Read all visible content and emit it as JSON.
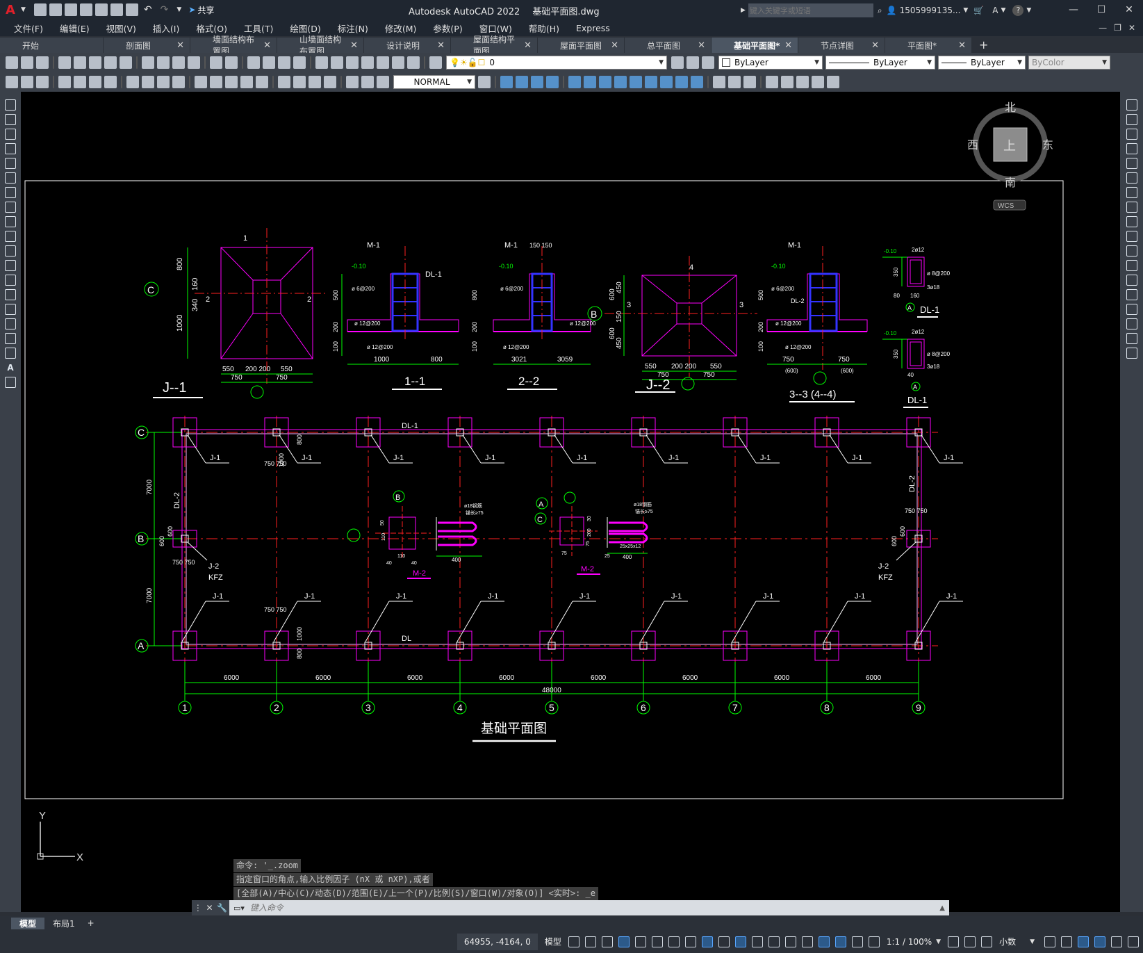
{
  "app": {
    "title": "Autodesk AutoCAD 2022",
    "filename": "基础平面图.dwg",
    "share_label": "共享",
    "search_placeholder": "键入关键字或短语",
    "user": "1505999135...",
    "help": "?"
  },
  "menu": [
    "文件(F)",
    "编辑(E)",
    "视图(V)",
    "插入(I)",
    "格式(O)",
    "工具(T)",
    "绘图(D)",
    "标注(N)",
    "修改(M)",
    "参数(P)",
    "窗口(W)",
    "帮助(H)",
    "Express"
  ],
  "tabs": [
    {
      "label": "开始",
      "active": false
    },
    {
      "label": "剖面图",
      "active": false
    },
    {
      "label": "墙面结构布置图",
      "active": false
    },
    {
      "label": "山墙面结构布置图",
      "active": false
    },
    {
      "label": "设计说明",
      "active": false
    },
    {
      "label": "屋面结构平面图",
      "active": false
    },
    {
      "label": "屋面平面图",
      "active": false
    },
    {
      "label": "总平面图",
      "active": false
    },
    {
      "label": "基础平面图*",
      "active": true
    },
    {
      "label": "节点详图",
      "active": false
    },
    {
      "label": "平面图*",
      "active": false
    }
  ],
  "toolbar": {
    "layer_value": "0",
    "color_value": "ByLayer",
    "linetype_value": "ByLayer",
    "lineweight_value": "ByLayer",
    "plotstyle_value": "ByColor",
    "dimstyle_value": "NORMAL"
  },
  "viewcube": {
    "north": "北",
    "south": "南",
    "east": "东",
    "west": "西",
    "top": "上",
    "wcs": "WCS"
  },
  "drawing": {
    "title": "基础平面图",
    "section_labels": [
      "J--1",
      "1--1",
      "2--2",
      "J--2",
      "3--3 (4--4)",
      "DL-1",
      "DL-1"
    ],
    "axis_rows": [
      "C",
      "B",
      "A"
    ],
    "axis_cols": [
      "1",
      "2",
      "3",
      "4",
      "5",
      "6",
      "7",
      "8",
      "9"
    ],
    "bay_width": "6000",
    "total_width": "48000",
    "row_spacing": "7000",
    "labels": {
      "j1": "J-1",
      "j2": "J-2",
      "kfz": "KFZ",
      "dl1": "DL-1",
      "dl2": "DL-2",
      "dl": "DL",
      "m1": "M-1",
      "m2": "M-2"
    },
    "dims": {
      "d800": "800",
      "d1000": "1000",
      "d340": "340",
      "d160": "160",
      "d550": "550",
      "d200": "200",
      "d750": "750",
      "d600": "600",
      "d450": "450",
      "d150": "150",
      "d3021": "3021",
      "d3059": "3059",
      "d500": "500",
      "d100": "100",
      "d350": "350",
      "d80": "80",
      "d400": "400",
      "d40": "40",
      "d110": "110",
      "d75": "75",
      "d25": "25",
      "d50": "50",
      "d20": "20",
      "d30": "30",
      "d1": "1",
      "d2": "2",
      "d3": "3",
      "d4": "4"
    },
    "dim_pair_750": "750 750",
    "dim_pair_200": "200 200",
    "dim_pair_150": "150 150",
    "dim_par_600": "(600)",
    "rebar": {
      "r1": "ø 6@200",
      "r2": "ø 12@200",
      "r3": "2ø12",
      "r4": "ø 8@200",
      "r5": "3ø18",
      "r6": "ø18钢筋",
      "r7": "锚长≥75",
      "r8": "2ø12",
      "r9": "-0.10",
      "r10": "25x25x12"
    }
  },
  "command_history": [
    "命令: '_.zoom",
    "指定窗口的角点,输入比例因子 (nX 或 nXP),或者",
    "[全部(A)/中心(C)/动态(D)/范围(E)/上一个(P)/比例(S)/窗口(W)/对象(O)] <实时>: _e"
  ],
  "command_placeholder": "键入命令",
  "layout_tabs": [
    {
      "label": "模型",
      "active": true
    },
    {
      "label": "布局1",
      "active": false
    }
  ],
  "status": {
    "coords": "64955, -4164, 0",
    "model": "模型",
    "scale": "1:1 / 100%",
    "units": "小数"
  },
  "colors": {
    "canvas": "#000000",
    "magenta": "#ff00ff",
    "green": "#00ff00",
    "red": "#ff0000",
    "blue": "#3333ff",
    "white": "#ffffff"
  }
}
